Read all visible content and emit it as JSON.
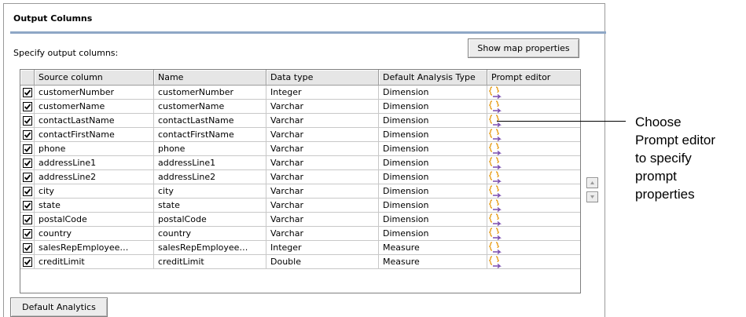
{
  "panel": {
    "title": "Output Columns",
    "specify_label": "Specify output columns:",
    "show_map_button": "Show map properties",
    "default_analytics_button": "Default Analytics"
  },
  "table": {
    "columns": [
      "",
      "Source column",
      "Name",
      "Data type",
      "Default Analysis Type",
      "Prompt editor"
    ],
    "rows": [
      {
        "checked": true,
        "source": "customerNumber",
        "name": "customerNumber",
        "type": "Integer",
        "analysis": "Dimension",
        "prompt_icon": "prompt-editor-icon"
      },
      {
        "checked": true,
        "source": "customerName",
        "name": "customerName",
        "type": "Varchar",
        "analysis": "Dimension",
        "prompt_icon": "prompt-editor-icon"
      },
      {
        "checked": true,
        "source": "contactLastName",
        "name": "contactLastName",
        "type": "Varchar",
        "analysis": "Dimension",
        "prompt_icon": "prompt-editor-icon"
      },
      {
        "checked": true,
        "source": "contactFirstName",
        "name": "contactFirstName",
        "type": "Varchar",
        "analysis": "Dimension",
        "prompt_icon": "prompt-editor-icon"
      },
      {
        "checked": true,
        "source": "phone",
        "name": "phone",
        "type": "Varchar",
        "analysis": "Dimension",
        "prompt_icon": "prompt-editor-icon"
      },
      {
        "checked": true,
        "source": "addressLine1",
        "name": "addressLine1",
        "type": "Varchar",
        "analysis": "Dimension",
        "prompt_icon": "prompt-editor-icon"
      },
      {
        "checked": true,
        "source": "addressLine2",
        "name": "addressLine2",
        "type": "Varchar",
        "analysis": "Dimension",
        "prompt_icon": "prompt-editor-icon"
      },
      {
        "checked": true,
        "source": "city",
        "name": "city",
        "type": "Varchar",
        "analysis": "Dimension",
        "prompt_icon": "prompt-editor-icon"
      },
      {
        "checked": true,
        "source": "state",
        "name": "state",
        "type": "Varchar",
        "analysis": "Dimension",
        "prompt_icon": "prompt-editor-icon"
      },
      {
        "checked": true,
        "source": "postalCode",
        "name": "postalCode",
        "type": "Varchar",
        "analysis": "Dimension",
        "prompt_icon": "prompt-editor-icon"
      },
      {
        "checked": true,
        "source": "country",
        "name": "country",
        "type": "Varchar",
        "analysis": "Dimension",
        "prompt_icon": "prompt-editor-icon"
      },
      {
        "checked": true,
        "source": "salesRepEmployee…",
        "name": "salesRepEmployee…",
        "type": "Integer",
        "analysis": "Measure",
        "prompt_icon": "prompt-editor-icon"
      },
      {
        "checked": true,
        "source": "creditLimit",
        "name": "creditLimit",
        "type": "Double",
        "analysis": "Measure",
        "prompt_icon": "prompt-editor-icon"
      }
    ]
  },
  "scroll": {
    "up_icon": "arrow-up-icon",
    "down_icon": "arrow-down-icon"
  },
  "callout": {
    "lines": [
      "Choose",
      "Prompt editor",
      "to specify",
      "prompt",
      "properties"
    ]
  },
  "colors": {
    "title_rule": "#8ea7c6",
    "header_bg": "#e6e6e6",
    "button_bg": "#ececec",
    "icon_orange": "#e8a020",
    "icon_purple": "#7a4db0"
  }
}
